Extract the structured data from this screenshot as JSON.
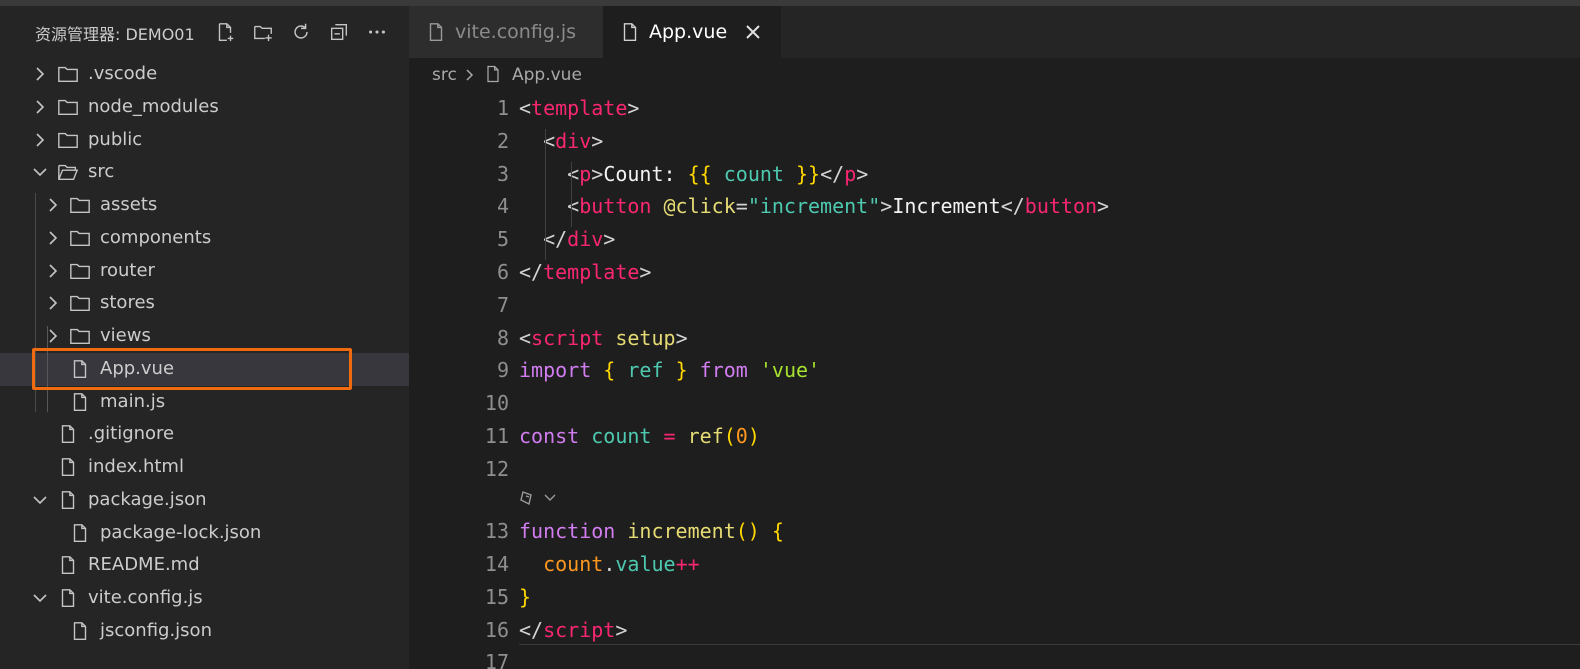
{
  "explorer": {
    "title": "资源管理器: DEMO01",
    "actions": [
      {
        "name": "new-file-icon"
      },
      {
        "name": "new-folder-icon"
      },
      {
        "name": "refresh-icon"
      },
      {
        "name": "collapse-all-icon"
      },
      {
        "name": "more-icon"
      }
    ],
    "tree": [
      {
        "label": ".vscode",
        "type": "folder",
        "depth": 0,
        "expanded": false
      },
      {
        "label": "node_modules",
        "type": "folder",
        "depth": 0,
        "expanded": false
      },
      {
        "label": "public",
        "type": "folder",
        "depth": 0,
        "expanded": false
      },
      {
        "label": "src",
        "type": "folder",
        "depth": 0,
        "expanded": true
      },
      {
        "label": "assets",
        "type": "folder",
        "depth": 1,
        "expanded": false
      },
      {
        "label": "components",
        "type": "folder",
        "depth": 1,
        "expanded": false
      },
      {
        "label": "router",
        "type": "folder",
        "depth": 1,
        "expanded": false
      },
      {
        "label": "stores",
        "type": "folder",
        "depth": 1,
        "expanded": false
      },
      {
        "label": "views",
        "type": "folder",
        "depth": 1,
        "expanded": false
      },
      {
        "label": "App.vue",
        "type": "file",
        "depth": 1,
        "selected": true
      },
      {
        "label": "main.js",
        "type": "file",
        "depth": 1
      },
      {
        "label": ".gitignore",
        "type": "file",
        "depth": 0
      },
      {
        "label": "index.html",
        "type": "file",
        "depth": 0
      },
      {
        "label": "package.json",
        "type": "file",
        "depth": 0,
        "expanded": true
      },
      {
        "label": "package-lock.json",
        "type": "file",
        "depth": 1
      },
      {
        "label": "README.md",
        "type": "file",
        "depth": 0
      },
      {
        "label": "vite.config.js",
        "type": "file",
        "depth": 0,
        "expanded": true
      },
      {
        "label": "jsconfig.json",
        "type": "file",
        "depth": 1
      }
    ],
    "highlight_color": "#f06a10"
  },
  "tabs": [
    {
      "label": "vite.config.js",
      "active": false
    },
    {
      "label": "App.vue",
      "active": true
    }
  ],
  "breadcrumb": {
    "folder": "src",
    "file": "App.vue"
  },
  "code": {
    "lines": [
      {
        "n": "1",
        "tokens": [
          [
            "<",
            "pun"
          ],
          [
            "template",
            "tag"
          ],
          [
            ">",
            "pun"
          ]
        ]
      },
      {
        "n": "2",
        "tokens": [
          [
            "  <",
            "pun"
          ],
          [
            "div",
            "tag"
          ],
          [
            ">",
            "pun"
          ]
        ]
      },
      {
        "n": "3",
        "tokens": [
          [
            "    <",
            "pun"
          ],
          [
            "p",
            "tag"
          ],
          [
            ">",
            "pun"
          ],
          [
            "Count: ",
            "txt"
          ],
          [
            "{{",
            "mus"
          ],
          [
            " count ",
            "var"
          ],
          [
            "}}",
            "mus"
          ],
          [
            "</",
            "pun"
          ],
          [
            "p",
            "tag"
          ],
          [
            ">",
            "pun"
          ]
        ]
      },
      {
        "n": "4",
        "tokens": [
          [
            "    <",
            "pun"
          ],
          [
            "button",
            "tag"
          ],
          [
            " ",
            "txt"
          ],
          [
            "@click",
            "attr"
          ],
          [
            "=",
            "pun"
          ],
          [
            "\"increment\"",
            "str"
          ],
          [
            ">",
            "pun"
          ],
          [
            "Increment",
            "txt"
          ],
          [
            "</",
            "pun"
          ],
          [
            "button",
            "tag"
          ],
          [
            ">",
            "pun"
          ]
        ]
      },
      {
        "n": "5",
        "tokens": [
          [
            "  </",
            "pun"
          ],
          [
            "div",
            "tag"
          ],
          [
            ">",
            "pun"
          ]
        ]
      },
      {
        "n": "6",
        "tokens": [
          [
            "</",
            "pun"
          ],
          [
            "template",
            "tag"
          ],
          [
            ">",
            "pun"
          ]
        ]
      },
      {
        "n": "7",
        "tokens": []
      },
      {
        "n": "8",
        "tokens": [
          [
            "<",
            "pun"
          ],
          [
            "script",
            "tag"
          ],
          [
            " ",
            "txt"
          ],
          [
            "setup",
            "attr"
          ],
          [
            ">",
            "pun"
          ]
        ]
      },
      {
        "n": "9",
        "tokens": [
          [
            "import",
            "kw2"
          ],
          [
            " ",
            "txt"
          ],
          [
            "{",
            "brk"
          ],
          [
            " ref ",
            "var"
          ],
          [
            "}",
            "brk"
          ],
          [
            " ",
            "txt"
          ],
          [
            "from",
            "kw2"
          ],
          [
            " ",
            "txt"
          ],
          [
            "'vue'",
            "sqs"
          ]
        ]
      },
      {
        "n": "10",
        "tokens": []
      },
      {
        "n": "11",
        "tokens": [
          [
            "const",
            "kw2"
          ],
          [
            " ",
            "txt"
          ],
          [
            "count",
            "var"
          ],
          [
            " ",
            "txt"
          ],
          [
            "=",
            "op"
          ],
          [
            " ",
            "txt"
          ],
          [
            "ref",
            "fn"
          ],
          [
            "(",
            "brk"
          ],
          [
            "0",
            "num"
          ],
          [
            ")",
            "brk"
          ]
        ]
      },
      {
        "n": "12",
        "tokens": []
      },
      {
        "n": "",
        "tokens": [],
        "codelens": true
      },
      {
        "n": "13",
        "tokens": [
          [
            "function",
            "kw2"
          ],
          [
            " ",
            "txt"
          ],
          [
            "increment",
            "fn"
          ],
          [
            "()",
            "brk"
          ],
          [
            " ",
            "txt"
          ],
          [
            "{",
            "brk"
          ]
        ]
      },
      {
        "n": "14",
        "tokens": [
          [
            "  ",
            "txt"
          ],
          [
            "count",
            "orange"
          ],
          [
            ".",
            "pun"
          ],
          [
            "value",
            "var"
          ],
          [
            "++",
            "op"
          ]
        ]
      },
      {
        "n": "15",
        "tokens": [
          [
            "}",
            "brk"
          ]
        ]
      },
      {
        "n": "16",
        "tokens": [
          [
            "</",
            "pun"
          ],
          [
            "script",
            "tag"
          ],
          [
            ">",
            "pun"
          ]
        ]
      },
      {
        "n": "17",
        "tokens": []
      }
    ]
  }
}
